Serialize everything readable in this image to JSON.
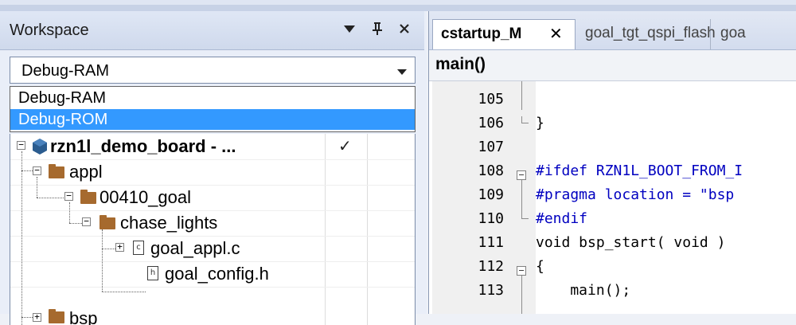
{
  "workspace": {
    "title": "Workspace",
    "buttons": {
      "menu": "▼",
      "pin": "ᵖ",
      "close": "✕"
    },
    "configuration": {
      "selected": "Debug-RAM",
      "options": [
        "Debug-RAM",
        "Debug-ROM"
      ],
      "highlighted": "Debug-ROM"
    },
    "tree": {
      "project": {
        "label": "rzn1l_demo_board - ...",
        "checked": "✓",
        "expander": "−"
      },
      "items": [
        {
          "label": "appl",
          "type": "folder",
          "expander": "−"
        },
        {
          "label": "00410_goal",
          "type": "folder",
          "expander": "−"
        },
        {
          "label": "chase_lights",
          "type": "folder",
          "expander": "−"
        },
        {
          "label": "goal_appl.c",
          "type": "c-file",
          "expander": "+",
          "file_glyph": "c"
        },
        {
          "label": "goal_config.h",
          "type": "h-file",
          "file_glyph": "h"
        },
        {
          "label": "bsp",
          "type": "folder",
          "expander": "+"
        }
      ]
    }
  },
  "editor": {
    "tabs": [
      {
        "label": "cstartup_M",
        "close": "✕",
        "active": true
      },
      {
        "label": "goal_tgt_qspi_flash",
        "active": false
      },
      {
        "label": "goa",
        "active": false
      }
    ],
    "function_bar": "main()",
    "lines": [
      {
        "num": "105",
        "code": ""
      },
      {
        "num": "106",
        "code": "}"
      },
      {
        "num": "107",
        "code": ""
      },
      {
        "num": "108",
        "code": "#ifdef RZN1L_BOOT_FROM_I"
      },
      {
        "num": "109",
        "code": "#pragma location = \"bsp"
      },
      {
        "num": "110",
        "code": "#endif"
      },
      {
        "num": "111",
        "code": "void bsp_start( void )"
      },
      {
        "num": "112",
        "code": "{"
      },
      {
        "num": "113",
        "code": "    main();"
      }
    ]
  },
  "colors": {
    "selection": "#3399ff",
    "folder": "#a66a2e",
    "project_icon": "#2b5c8f",
    "preprocessor": "#0000c0"
  }
}
